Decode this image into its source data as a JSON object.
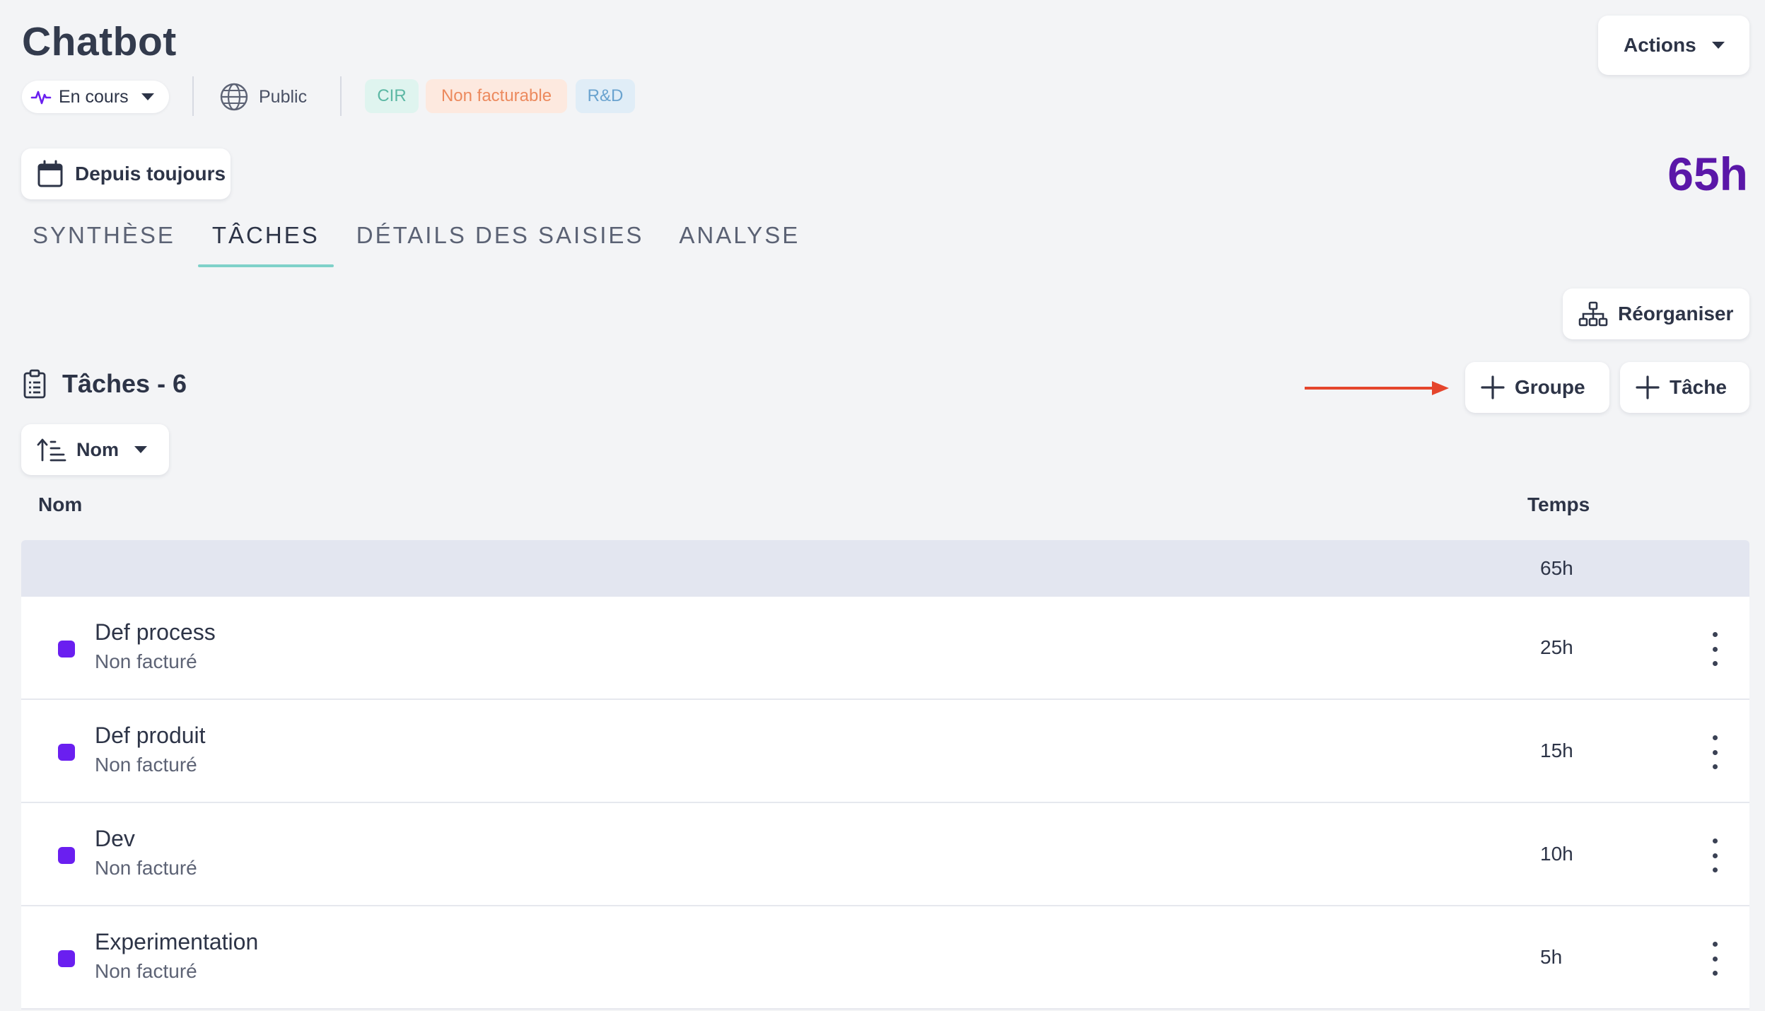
{
  "project": {
    "title": "Chatbot",
    "status": "En cours",
    "visibility": "Public",
    "tags": [
      {
        "label": "CIR",
        "bg": "#dff4ef",
        "color": "#5cb8a4"
      },
      {
        "label": "Non facturable",
        "bg": "#fde9df",
        "color": "#ec8a5e"
      },
      {
        "label": "R&D",
        "bg": "#e0edf7",
        "color": "#6aa3cf"
      }
    ]
  },
  "header": {
    "actions_label": "Actions",
    "date_filter_label": "Depuis toujours",
    "total_time": "65h"
  },
  "tabs": [
    {
      "label": "SYNTHÈSE",
      "active": false
    },
    {
      "label": "TÂCHES",
      "active": true
    },
    {
      "label": "DÉTAILS DES SAISIES",
      "active": false
    },
    {
      "label": "ANALYSE",
      "active": false
    }
  ],
  "toolbar": {
    "reorganize_label": "Réorganiser",
    "section_title": "Tâches - 6",
    "add_group_label": "Groupe",
    "add_task_label": "Tâche",
    "sort_label": "Nom"
  },
  "table": {
    "columns": {
      "name": "Nom",
      "time": "Temps"
    },
    "group_total": "65h",
    "rows": [
      {
        "name": "Def process",
        "billing": "Non facturé",
        "time": "25h"
      },
      {
        "name": "Def produit",
        "billing": "Non facturé",
        "time": "15h"
      },
      {
        "name": "Dev",
        "billing": "Non facturé",
        "time": "10h"
      },
      {
        "name": "Experimentation",
        "billing": "Non facturé",
        "time": "5h"
      }
    ]
  },
  "colors": {
    "accent_purple": "#5a17a8",
    "task_dot": "#6a1ff0",
    "tab_underline": "#7fd1c9",
    "arrow": "#e5452c"
  }
}
